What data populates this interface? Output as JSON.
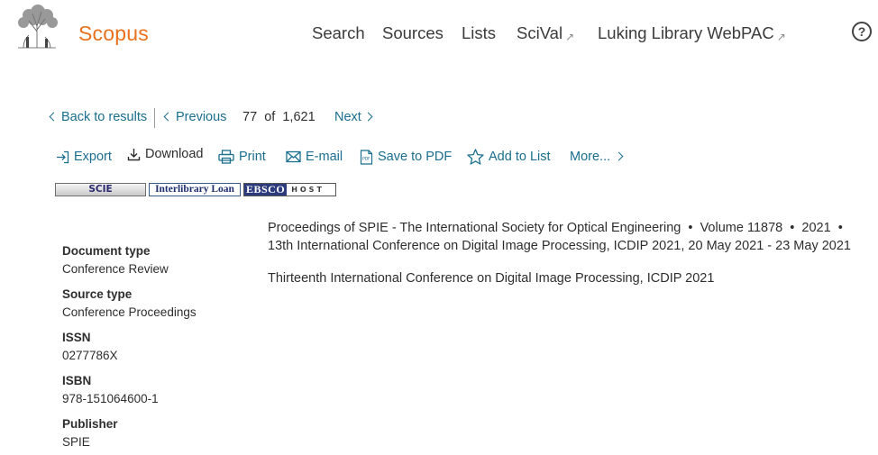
{
  "header": {
    "logo_text": "Scopus",
    "nav": [
      {
        "label": "Search",
        "external": false
      },
      {
        "label": "Sources",
        "external": false
      },
      {
        "label": "Lists",
        "external": false
      },
      {
        "label": "SciVal",
        "external": true
      },
      {
        "label": "Luking Library WebPAC",
        "external": true
      }
    ],
    "external_glyph": "↗",
    "help_label": "?",
    "help_icon": "help-circle-icon"
  },
  "result_nav": {
    "back": "Back to results",
    "previous": "Previous",
    "current": "77",
    "of": "of",
    "total": "1,621",
    "next": "Next"
  },
  "actions": {
    "export": "Export",
    "download": "Download",
    "print": "Print",
    "email": "E-mail",
    "save_pdf": "Save to PDF",
    "add_list": "Add to List",
    "more": "More..."
  },
  "badges": {
    "scie": "SCIE",
    "interlibrary": "Interlibrary Loan",
    "ebsco_a": "EBSCO",
    "ebsco_b": "HOST"
  },
  "source": {
    "line1_parts": [
      "Proceedings of SPIE - The International Society for Optical Engineering",
      "Volume 11878",
      "2021"
    ],
    "separator": "•",
    "line2": "13th International Conference on Digital Image Processing, ICDIP 2021, 20 May 2021 - 23 May 2021",
    "title": "Thirteenth International Conference on Digital Image Processing, ICDIP 2021"
  },
  "metadata": [
    {
      "label": "Document type",
      "value": "Conference Review"
    },
    {
      "label": "Source type",
      "value": "Conference Proceedings"
    },
    {
      "label": "ISSN",
      "value": "0277786X"
    },
    {
      "label": "ISBN",
      "value": "978-151064600-1"
    },
    {
      "label": "Publisher",
      "value": "SPIE"
    }
  ],
  "colors": {
    "brand": "#e9711c",
    "link": "#1a6e8e",
    "text": "#2e2e2e"
  }
}
